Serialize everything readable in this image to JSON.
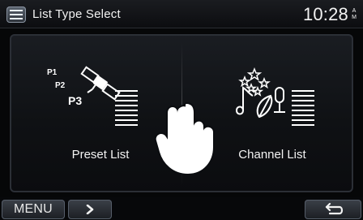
{
  "header": {
    "title": "List Type Select",
    "time": "10:28",
    "ampm_top": "A",
    "ampm_bottom": "M",
    "icon": "list-type-icon"
  },
  "choices": [
    {
      "label": "Preset List",
      "icon": "preset-list-icon",
      "preset_labels": [
        "P1",
        "P2",
        "P3"
      ]
    },
    {
      "label": "Channel List",
      "icon": "channel-list-icon"
    }
  ],
  "footer": {
    "menu_label": "MENU",
    "next_icon": "chevron-right-icon",
    "back_icon": "back-arrow-icon"
  },
  "overlay": {
    "icon": "touch-hand-icon"
  },
  "colors": {
    "text": "#f2f2f2",
    "accent_bg": "#0b0d10"
  }
}
